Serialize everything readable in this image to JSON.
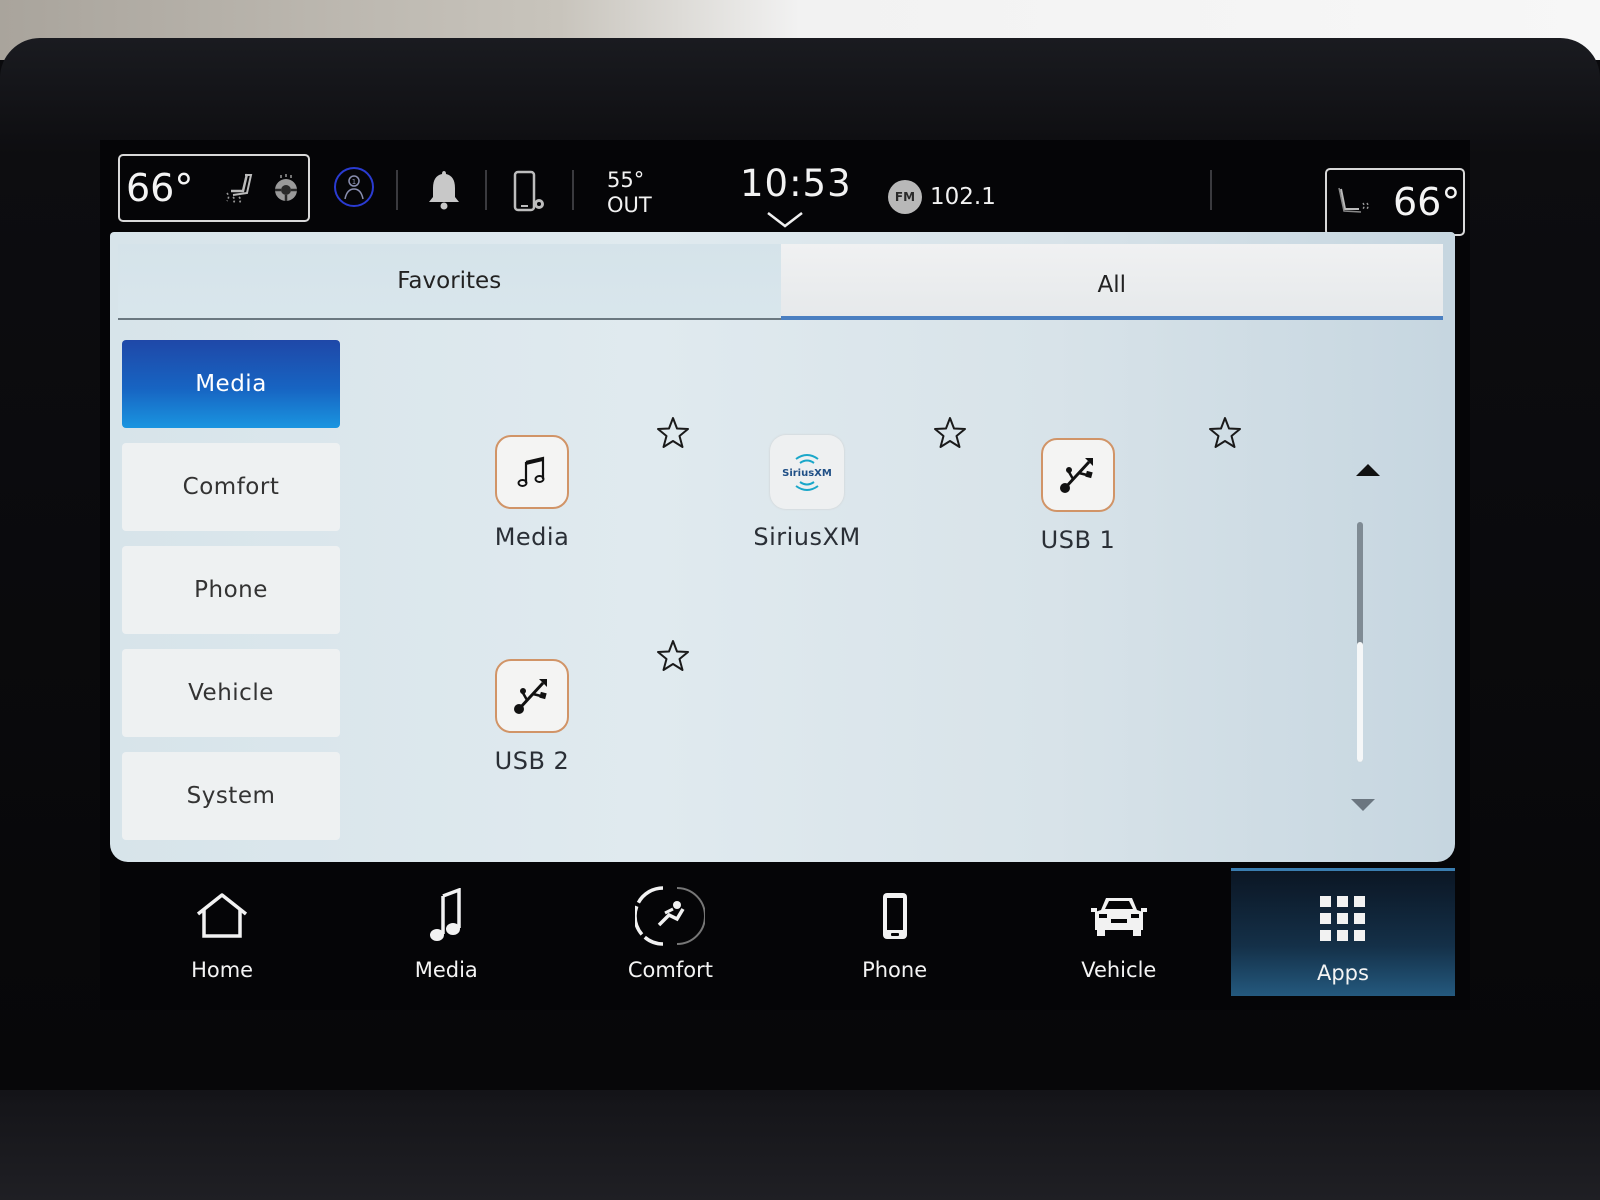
{
  "status_bar": {
    "driver_temp": "66°",
    "passenger_temp": "66°",
    "outside_temp": "55°",
    "outside_label": "OUT",
    "clock": "10:53",
    "radio_band": "FM",
    "radio_frequency": "102.1",
    "icons": {
      "driver_climate": [
        "heated-seat-icon",
        "heated-steering-wheel-icon"
      ],
      "passenger_climate": [
        "heated-seat-icon"
      ],
      "driver_assist": "driver-profile-icon",
      "notifications": "bell-icon",
      "phone_settings": "phone-settings-icon",
      "clock_expand": "chevron-down-icon"
    }
  },
  "tabs": [
    {
      "label": "Favorites",
      "active": false
    },
    {
      "label": "All",
      "active": true
    }
  ],
  "categories": [
    {
      "label": "Media",
      "active": true
    },
    {
      "label": "Comfort",
      "active": false
    },
    {
      "label": "Phone",
      "active": false
    },
    {
      "label": "Vehicle",
      "active": false
    },
    {
      "label": "System",
      "active": false
    }
  ],
  "apps": [
    {
      "label": "Media",
      "icon": "music-note-icon",
      "favorite": false
    },
    {
      "label": "SiriusXM",
      "icon": "siriusxm-logo-icon",
      "icon_text": "SiriusXM",
      "favorite": false
    },
    {
      "label": "USB 1",
      "icon": "usb-icon",
      "favorite": false
    },
    {
      "label": "USB 2",
      "icon": "usb-icon",
      "favorite": false
    }
  ],
  "scrollbar": {
    "position": 0.5
  },
  "bottom_nav": [
    {
      "label": "Home",
      "icon": "home-icon",
      "active": false
    },
    {
      "label": "Media",
      "icon": "music-note-icon",
      "active": false
    },
    {
      "label": "Comfort",
      "icon": "comfort-seat-icon",
      "active": false
    },
    {
      "label": "Phone",
      "icon": "phone-icon",
      "active": false
    },
    {
      "label": "Vehicle",
      "icon": "car-icon",
      "active": false
    },
    {
      "label": "Apps",
      "icon": "apps-grid-icon",
      "active": true
    }
  ],
  "colors": {
    "accent_blue": "#1764c2",
    "app_icon_border": "#d19467",
    "sirius_teal": "#1aa7c9",
    "driver_assist_ring": "#2a3bd1"
  }
}
